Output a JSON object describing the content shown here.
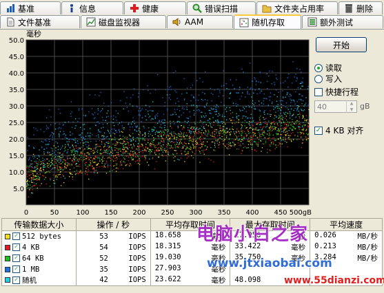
{
  "tabs_row1": [
    {
      "id": "benchmark",
      "label": "基准",
      "icon": "benchmark-icon",
      "color": "#1e5fb4"
    },
    {
      "id": "info",
      "label": "信息",
      "icon": "info-icon",
      "color": "#1e5fb4"
    },
    {
      "id": "health",
      "label": "健康",
      "icon": "health-cross-icon",
      "color": "#d81e1e"
    },
    {
      "id": "error-scan",
      "label": "错误扫描",
      "icon": "magnifier-icon",
      "color": "#2f8f2f"
    },
    {
      "id": "folder-usage",
      "label": "文件夹占用率",
      "icon": "folder-icon",
      "color": "#e0b02c"
    },
    {
      "id": "erase",
      "label": "删除",
      "icon": "trash-icon",
      "color": "#555555"
    }
  ],
  "tabs_row2": [
    {
      "id": "file-benchmark",
      "label": "文件基准",
      "icon": "file-icon",
      "active": false
    },
    {
      "id": "disk-monitor",
      "label": "磁盘监视器",
      "icon": "monitor-chart-icon",
      "active": false
    },
    {
      "id": "aam",
      "label": "AAM",
      "icon": "speaker-icon",
      "active": false
    },
    {
      "id": "random-access",
      "label": "随机存取",
      "icon": "random-access-icon",
      "active": true
    },
    {
      "id": "extra-tests",
      "label": "额外测试",
      "icon": "extra-tests-icon",
      "active": false
    }
  ],
  "controls": {
    "start_label": "开始",
    "read_label": "读取",
    "write_label": "写入",
    "read_selected": true,
    "write_selected": false,
    "short_stroke_label": "快捷行程",
    "short_stroke_checked": false,
    "stroke_value": "40",
    "stroke_unit": "gB",
    "align_label": "4 KB 对齐",
    "align_checked": true
  },
  "table": {
    "headers": [
      "传输数据大小",
      "操作 / 秒",
      "平均存取时间",
      "最大存取时间",
      "平均速度"
    ],
    "rows": [
      {
        "name": "512 bytes",
        "color": "#f0e020",
        "iops": "53",
        "iops_unit": "IOPS",
        "avg": "18.658",
        "avg_unit": "毫秒",
        "max": "27.958",
        "max_unit": "毫秒",
        "speed": "0.026",
        "speed_unit": "MB/秒"
      },
      {
        "name": "4 KB",
        "color": "#e02020",
        "iops": "54",
        "iops_unit": "IOPS",
        "avg": "18.315",
        "avg_unit": "毫秒",
        "max": "33.422",
        "max_unit": "毫秒",
        "speed": "0.213",
        "speed_unit": "MB/秒"
      },
      {
        "name": "64 KB",
        "color": "#20c020",
        "iops": "52",
        "iops_unit": "IOPS",
        "avg": "19.030",
        "avg_unit": "毫秒",
        "max": "35.750",
        "max_unit": "毫秒",
        "speed": "3.284",
        "speed_unit": "MB/秒"
      },
      {
        "name": "1 MB",
        "color": "#2070e0",
        "iops": "35",
        "iops_unit": "IOPS",
        "avg": "27.903",
        "avg_unit": "毫秒",
        "max": "",
        "max_unit": "",
        "speed": "",
        "speed_unit": ""
      },
      {
        "name": "随机",
        "color": "#20d0e0",
        "iops": "42",
        "iops_unit": "IOPS",
        "avg": "23.622",
        "avg_unit": "毫秒",
        "max": "48.098",
        "max_unit": "",
        "speed": "",
        "speed_unit": ""
      }
    ]
  },
  "watermarks": {
    "brand": "电脑小白之家",
    "url1": "www.jtxiaobai.com",
    "url2": "www.55dianzi.com"
  },
  "chart_data": {
    "type": "scatter",
    "ylabel": "毫秒",
    "xunit": "gB",
    "xlim": [
      0,
      500
    ],
    "ylim": [
      0,
      50
    ],
    "xticks": [
      0,
      50,
      100,
      150,
      200,
      250,
      300,
      350,
      400,
      450,
      500
    ],
    "xtick_labels": [
      "0",
      "50",
      "100",
      "150",
      "200",
      "250",
      "300",
      "350",
      "400",
      "450",
      "500gB"
    ],
    "yticks": [
      5,
      10,
      15,
      20,
      25,
      30,
      35,
      40,
      45,
      50
    ],
    "ytick_labels": [
      "5.0",
      "10.0",
      "15.0",
      "20.0",
      "25.0",
      "30.0",
      "35.0",
      "40.0",
      "45.0",
      "50.0"
    ],
    "grid": true,
    "background": "#000000",
    "series": [
      {
        "name": "512 bytes",
        "color": "#f0e020",
        "trend": [
          [
            0,
            8
          ],
          [
            50,
            12
          ],
          [
            100,
            14
          ],
          [
            200,
            17.5
          ],
          [
            300,
            20
          ],
          [
            400,
            22
          ],
          [
            500,
            24
          ]
        ],
        "spread": 6
      },
      {
        "name": "4 KB",
        "color": "#e02020",
        "trend": [
          [
            0,
            7.5
          ],
          [
            50,
            11.5
          ],
          [
            100,
            13.5
          ],
          [
            200,
            17
          ],
          [
            300,
            19.5
          ],
          [
            400,
            21.5
          ],
          [
            500,
            23.5
          ]
        ],
        "spread": 6
      },
      {
        "name": "64 KB",
        "color": "#20c020",
        "trend": [
          [
            0,
            8.5
          ],
          [
            50,
            12.5
          ],
          [
            100,
            14.5
          ],
          [
            200,
            18
          ],
          [
            300,
            20.5
          ],
          [
            400,
            22.5
          ],
          [
            500,
            24.5
          ]
        ],
        "spread": 6
      },
      {
        "name": "1 MB",
        "color": "#2070e0",
        "trend": [
          [
            0,
            14
          ],
          [
            50,
            20
          ],
          [
            100,
            23
          ],
          [
            200,
            27
          ],
          [
            300,
            30
          ],
          [
            400,
            33
          ],
          [
            500,
            35
          ]
        ],
        "spread": 10
      },
      {
        "name": "随机",
        "color": "#20d0e0",
        "trend": [
          [
            0,
            11
          ],
          [
            50,
            16
          ],
          [
            100,
            19
          ],
          [
            200,
            22.5
          ],
          [
            300,
            25
          ],
          [
            400,
            27.5
          ],
          [
            500,
            29.5
          ]
        ],
        "spread": 9
      }
    ]
  }
}
